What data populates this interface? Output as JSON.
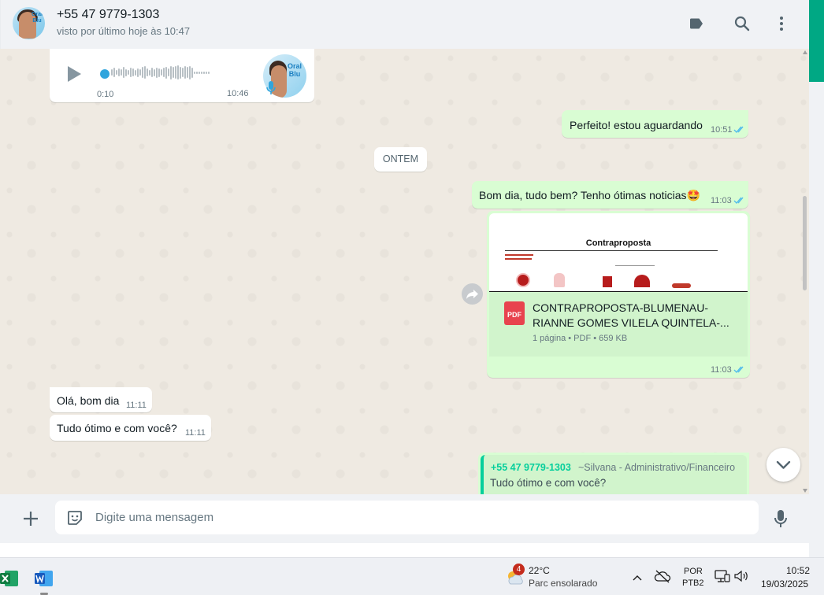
{
  "header": {
    "contact_name": "+55 47 9779-1303",
    "contact_status": "visto por último hoje às 10:47",
    "avatar_brand": "Oral Blu"
  },
  "messages": {
    "audio": {
      "elapsed": "0:10",
      "time": "10:46",
      "brand": "Oral Blu"
    },
    "msg1": {
      "text": "Perfeito! estou aguardando",
      "time": "10:51"
    },
    "date_separator": "ONTEM",
    "msg2": {
      "text": "Bom dia, tudo bem? Tenho ótimas noticias",
      "emoji": "🤩",
      "time": "11:03"
    },
    "doc": {
      "preview_title": "Contraproposta",
      "filename_line1": "CONTRAPROPOSTA-BLUMENAU-",
      "filename_line2": "RIANNE GOMES VILELA QUINTELA-...",
      "meta": "1 página • PDF • 659 KB",
      "pdf_label": "PDF",
      "time": "11:03"
    },
    "msg3": {
      "text": "Olá, bom dia",
      "time": "11:11"
    },
    "msg4": {
      "text": "Tudo ótimo e com você?",
      "time": "11:11"
    },
    "quote": {
      "author": "+55 47 9779-1303",
      "author_alias": "~Silvana - Administrativo/Financeiro",
      "text": "Tudo ótimo e com você?"
    }
  },
  "composer": {
    "placeholder": "Digite uma mensagem"
  },
  "taskbar": {
    "weather_badge": "4",
    "temperature": "22°C",
    "weather_desc": "Parc ensolarado",
    "lang_line1": "POR",
    "lang_line2": "PTB2",
    "clock_time": "10:52",
    "clock_date": "19/03/2025"
  },
  "colors": {
    "accent": "#00a884",
    "outgoing_bubble": "#d9fdd3",
    "incoming_bubble": "#ffffff",
    "read_ticks": "#53bdeb",
    "pdf_red": "#e8434e"
  }
}
